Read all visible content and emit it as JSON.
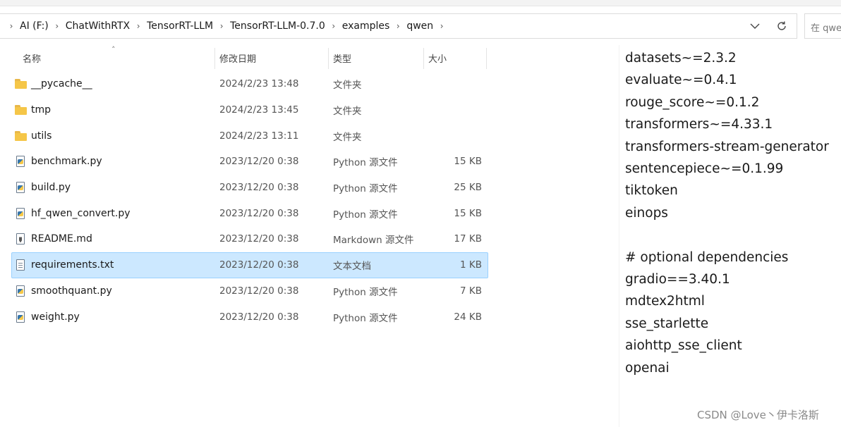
{
  "breadcrumb": [
    "AI (F:)",
    "ChatWithRTX",
    "TensorRT-LLM",
    "TensorRT-LLM-0.7.0",
    "examples",
    "qwen"
  ],
  "search": {
    "placeholder": "在 qwe"
  },
  "columns": {
    "name": "名称",
    "date": "修改日期",
    "type": "类型",
    "size": "大小"
  },
  "files": [
    {
      "name": "__pycache__",
      "date": "2024/2/23 13:48",
      "type": "文件夹",
      "size": "",
      "icon": "folder-icon"
    },
    {
      "name": "tmp",
      "date": "2024/2/23 13:45",
      "type": "文件夹",
      "size": "",
      "icon": "folder-icon"
    },
    {
      "name": "utils",
      "date": "2024/2/23 13:11",
      "type": "文件夹",
      "size": "",
      "icon": "folder-icon"
    },
    {
      "name": "benchmark.py",
      "date": "2023/12/20 0:38",
      "type": "Python 源文件",
      "size": "15 KB",
      "icon": "python-file-icon"
    },
    {
      "name": "build.py",
      "date": "2023/12/20 0:38",
      "type": "Python 源文件",
      "size": "25 KB",
      "icon": "python-file-icon"
    },
    {
      "name": "hf_qwen_convert.py",
      "date": "2023/12/20 0:38",
      "type": "Python 源文件",
      "size": "15 KB",
      "icon": "python-file-icon"
    },
    {
      "name": "README.md",
      "date": "2023/12/20 0:38",
      "type": "Markdown 源文件",
      "size": "17 KB",
      "icon": "markdown-file-icon"
    },
    {
      "name": "requirements.txt",
      "date": "2023/12/20 0:38",
      "type": "文本文档",
      "size": "1 KB",
      "icon": "text-file-icon",
      "selected": true
    },
    {
      "name": "smoothquant.py",
      "date": "2023/12/20 0:38",
      "type": "Python 源文件",
      "size": "7 KB",
      "icon": "python-file-icon"
    },
    {
      "name": "weight.py",
      "date": "2023/12/20 0:38",
      "type": "Python 源文件",
      "size": "24 KB",
      "icon": "python-file-icon"
    }
  ],
  "requirements": [
    "datasets~=2.3.2",
    "evaluate~=0.4.1",
    "rouge_score~=0.1.2",
    "transformers~=4.33.1",
    "transformers-stream-generator",
    "sentencepiece~=0.1.99",
    "tiktoken",
    "einops",
    "",
    "# optional dependencies",
    "gradio==3.40.1",
    "mdtex2html",
    "sse_starlette",
    "aiohttp_sse_client",
    "openai"
  ],
  "watermark": "CSDN @Love丶伊卡洛斯",
  "colors": {
    "selection": "#cce8ff",
    "selection_border": "#99d1ff",
    "folder": "#f5c648"
  }
}
